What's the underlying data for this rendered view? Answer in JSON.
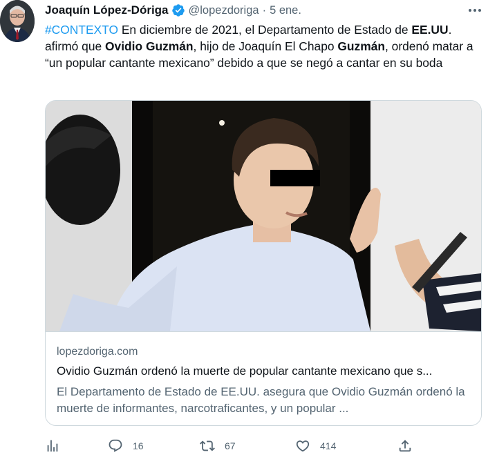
{
  "tweet": {
    "author_name": "Joaquín López-Dóriga",
    "handle": "@lopezdoriga",
    "separator": "·",
    "date": "5 ene.",
    "text_parts": {
      "hashtag": "#CONTEXTO",
      "t1": " En diciembre de 2021, el Departamento de Estado de ",
      "b1": "EE.UU",
      "t2": ". afirmó que ",
      "b2": "Ovidio Guzmán",
      "t3": ", hijo de Joaquín El Chapo ",
      "b3": "Guzmán",
      "t4": ", ordenó matar a “un popular cantante mexicano” debido a que se negó a cantar en su boda"
    }
  },
  "card": {
    "domain": "lopezdoriga.com",
    "title": "Ovidio Guzmán ordenó la muerte de popular cantante mexicano que s...",
    "description": "El Departamento de Estado de EE.UU. asegura que Ovidio Guzmán ordenó la muerte de informantes, narcotraficantes, y un popular ..."
  },
  "actions": {
    "replies": "16",
    "retweets": "67",
    "likes": "414"
  },
  "icons": {
    "more": "more-horizontal-icon",
    "verified": "verified-badge-icon",
    "analytics": "analytics-icon",
    "reply": "reply-icon",
    "retweet": "retweet-icon",
    "like": "heart-icon",
    "share": "share-icon"
  },
  "colors": {
    "accent": "#1d9bf0",
    "secondary_text": "#536471",
    "border": "#cfd9de"
  }
}
